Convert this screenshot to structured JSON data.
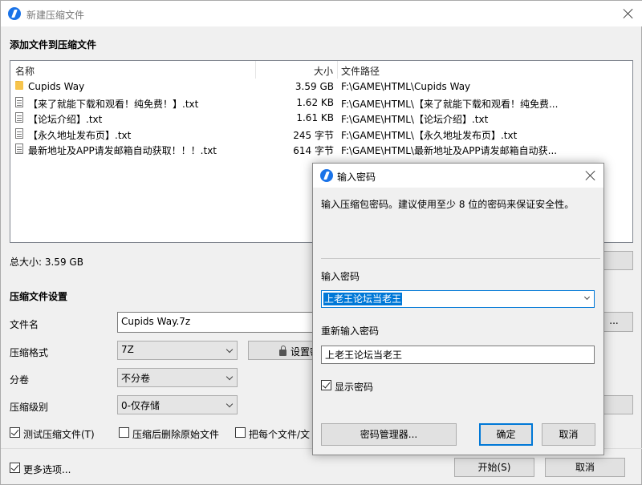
{
  "window": {
    "title": "新建压缩文件",
    "add_files_section": "添加文件到压缩文件",
    "columns": {
      "name": "名称",
      "size": "大小",
      "path": "文件路径"
    },
    "files": [
      {
        "icon": "folder-icon",
        "name": "Cupids Way",
        "size": "3.59 GB",
        "path": "F:\\GAME\\HTML\\Cupids Way"
      },
      {
        "icon": "file-icon",
        "name": "【来了就能下载和观看！纯免费！】.txt",
        "size": "1.62 KB",
        "path": "F:\\GAME\\HTML\\【来了就能下载和观看！纯免费..."
      },
      {
        "icon": "file-icon",
        "name": "【论坛介绍】.txt",
        "size": "1.61 KB",
        "path": "F:\\GAME\\HTML\\【论坛介绍】.txt"
      },
      {
        "icon": "file-icon",
        "name": "【永久地址发布页】.txt",
        "size": "245 字节",
        "path": "F:\\GAME\\HTML\\【永久地址发布页】.txt"
      },
      {
        "icon": "file-icon",
        "name": "最新地址及APP请发邮箱自动获取！！！.txt",
        "size": "614 字节",
        "path": "F:\\GAME\\HTML\\最新地址及APP请发邮箱自动获..."
      }
    ],
    "total_size": "总大小: 3.59 GB",
    "settings_section": "压缩文件设置",
    "filename_label": "文件名",
    "filename_value": "Cupids Way.7z",
    "format_label": "压缩格式",
    "format_value": "7Z",
    "set_password_label": "设置密",
    "volume_label": "分卷",
    "volume_value": "不分卷",
    "level_label": "压缩级别",
    "level_value": "0-仅存储",
    "test_label": "测试压缩文件(T)",
    "test_checked": true,
    "delete_label": "压缩后删除原始文件",
    "delete_checked": false,
    "each_label": "把每个文件/文",
    "each_checked": false,
    "more_label": "更多选项...",
    "more_checked": true,
    "start_button": "开始(S)",
    "cancel_button": "取消"
  },
  "dialog": {
    "title": "输入密码",
    "info": "输入压缩包密码。建议使用至少 8 位的密码来保证安全性。",
    "password_label": "输入密码",
    "password_value": "上老王论坛当老王",
    "repeat_label": "重新输入密码",
    "repeat_value": "上老王论坛当老王",
    "show_label": "显示密码",
    "show_checked": true,
    "manager_button": "密码管理器...",
    "ok_button": "确定",
    "cancel_button": "取消"
  },
  "colors": {
    "accent": "#0078d7",
    "folder": "#f7c44c"
  }
}
